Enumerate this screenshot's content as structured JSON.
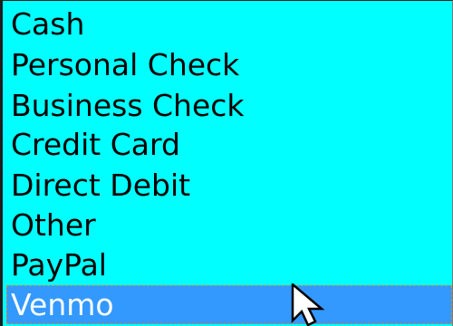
{
  "listbox": {
    "items": [
      {
        "label": "Cash"
      },
      {
        "label": "Personal Check"
      },
      {
        "label": "Business Check"
      },
      {
        "label": "Credit Card"
      },
      {
        "label": "Direct Debit"
      },
      {
        "label": "Other"
      },
      {
        "label": "PayPal"
      },
      {
        "label": "Venmo"
      }
    ],
    "selected": "Venmo"
  },
  "colors": {
    "list_background": "#00ffff",
    "selection_background": "#3399ff",
    "selection_text": "#ffffff",
    "focus_outline": "#d18a3a"
  },
  "icons": {
    "cursor": "arrow-pointer-icon"
  }
}
